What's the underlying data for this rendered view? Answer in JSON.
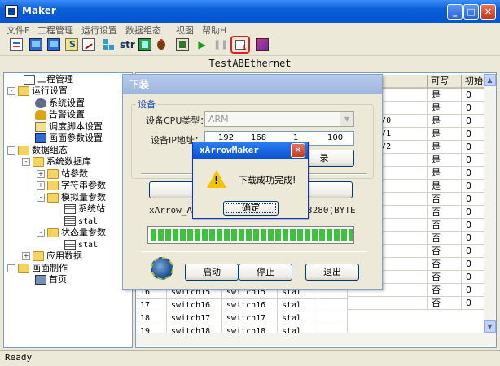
{
  "window": {
    "title": "Maker",
    "min": "_",
    "max": "□",
    "close": "✕"
  },
  "menu": [
    "文件F",
    "工程管理",
    "运行设置",
    "数据组态",
    "视图",
    "帮助H"
  ],
  "toolbar": {
    "str_label": "str"
  },
  "path_title": "TestABEthernet",
  "tree": [
    {
      "label": "工程管理",
      "level": 1,
      "icon": "page-icon",
      "exp": ""
    },
    {
      "label": "运行设置",
      "level": 0,
      "icon": "folder-icon",
      "exp": "-"
    },
    {
      "label": "系统设置",
      "level": 1,
      "icon": "gear-icon",
      "exp": ""
    },
    {
      "label": "告警设置",
      "level": 1,
      "icon": "bell-icon",
      "exp": ""
    },
    {
      "label": "调度脚本设置",
      "level": 1,
      "icon": "script-icon",
      "exp": ""
    },
    {
      "label": "画面参数设置",
      "level": 1,
      "icon": "screen-icon",
      "exp": ""
    },
    {
      "label": "数据组态",
      "level": 0,
      "icon": "folder-icon",
      "exp": "-"
    },
    {
      "label": "系统数据库",
      "level": 1,
      "icon": "folder-icon",
      "exp": "-"
    },
    {
      "label": "站参数",
      "level": 2,
      "icon": "folder-icon",
      "exp": "+"
    },
    {
      "label": "字符串参数",
      "level": 2,
      "icon": "folder-icon",
      "exp": "+"
    },
    {
      "label": "模拟量参数",
      "level": 2,
      "icon": "folder-icon",
      "exp": "-"
    },
    {
      "label": "系统站",
      "level": 3,
      "icon": "grid-icon",
      "exp": ""
    },
    {
      "label": "stal",
      "level": 3,
      "icon": "grid-icon",
      "exp": ""
    },
    {
      "label": "状态量参数",
      "level": 2,
      "icon": "folder-icon",
      "exp": "-"
    },
    {
      "label": "stal",
      "level": 3,
      "icon": "grid-icon",
      "exp": ""
    },
    {
      "label": "应用数据",
      "level": 1,
      "icon": "folder-icon",
      "exp": "+"
    },
    {
      "label": "画面制作",
      "level": 0,
      "icon": "folder-icon",
      "exp": "-"
    },
    {
      "label": "首页",
      "level": 1,
      "icon": "pc-icon",
      "exp": ""
    }
  ],
  "table": {
    "headers": [
      "址",
      "可写",
      "初始"
    ],
    "addr": [
      "",
      "",
      "ray[2]/0",
      "ray[2]/1",
      "ray[2]/2",
      "",
      "",
      "",
      "",
      "",
      "",
      "",
      "",
      "",
      "",
      "",
      ""
    ],
    "writable": [
      "是",
      "是",
      "是",
      "是",
      "是",
      "是",
      "是",
      "是",
      "否",
      "否",
      "否",
      "否",
      "否",
      "否",
      "否",
      "否",
      "否"
    ],
    "init": [
      "0",
      "0",
      "0",
      "0",
      "0",
      "0",
      "0",
      "0",
      "0",
      "0",
      "0",
      "0",
      "0",
      "0",
      "0",
      "0",
      "0"
    ],
    "bottom_rows": [
      {
        "id": "16",
        "name": "switch15",
        "tag": "switch15",
        "station": "stal"
      },
      {
        "id": "17",
        "name": "switch16",
        "tag": "switch16",
        "station": "stal"
      },
      {
        "id": "18",
        "name": "switch17",
        "tag": "switch17",
        "station": "stal"
      },
      {
        "id": "19",
        "name": "switch18",
        "tag": "switch18",
        "station": "stal"
      }
    ]
  },
  "download_dialog": {
    "title": "下装",
    "group_label": "设备",
    "cpu_label": "设备CPU类型：",
    "cpu_value": "ARM",
    "ip_label": "设备IP地址：",
    "ip": [
      "192",
      "168",
      "1",
      "100"
    ],
    "test_button_tail": "录",
    "log_left": "xArrow_ABE",
    "log_right": "3280(BYTE",
    "progress": 1.0,
    "start": "启动",
    "stop": "停止",
    "exit": "退出"
  },
  "message_box": {
    "title": "xArrowMaker",
    "text": "下载成功完成!",
    "ok": "确定",
    "close": "✕"
  },
  "status": "Ready"
}
